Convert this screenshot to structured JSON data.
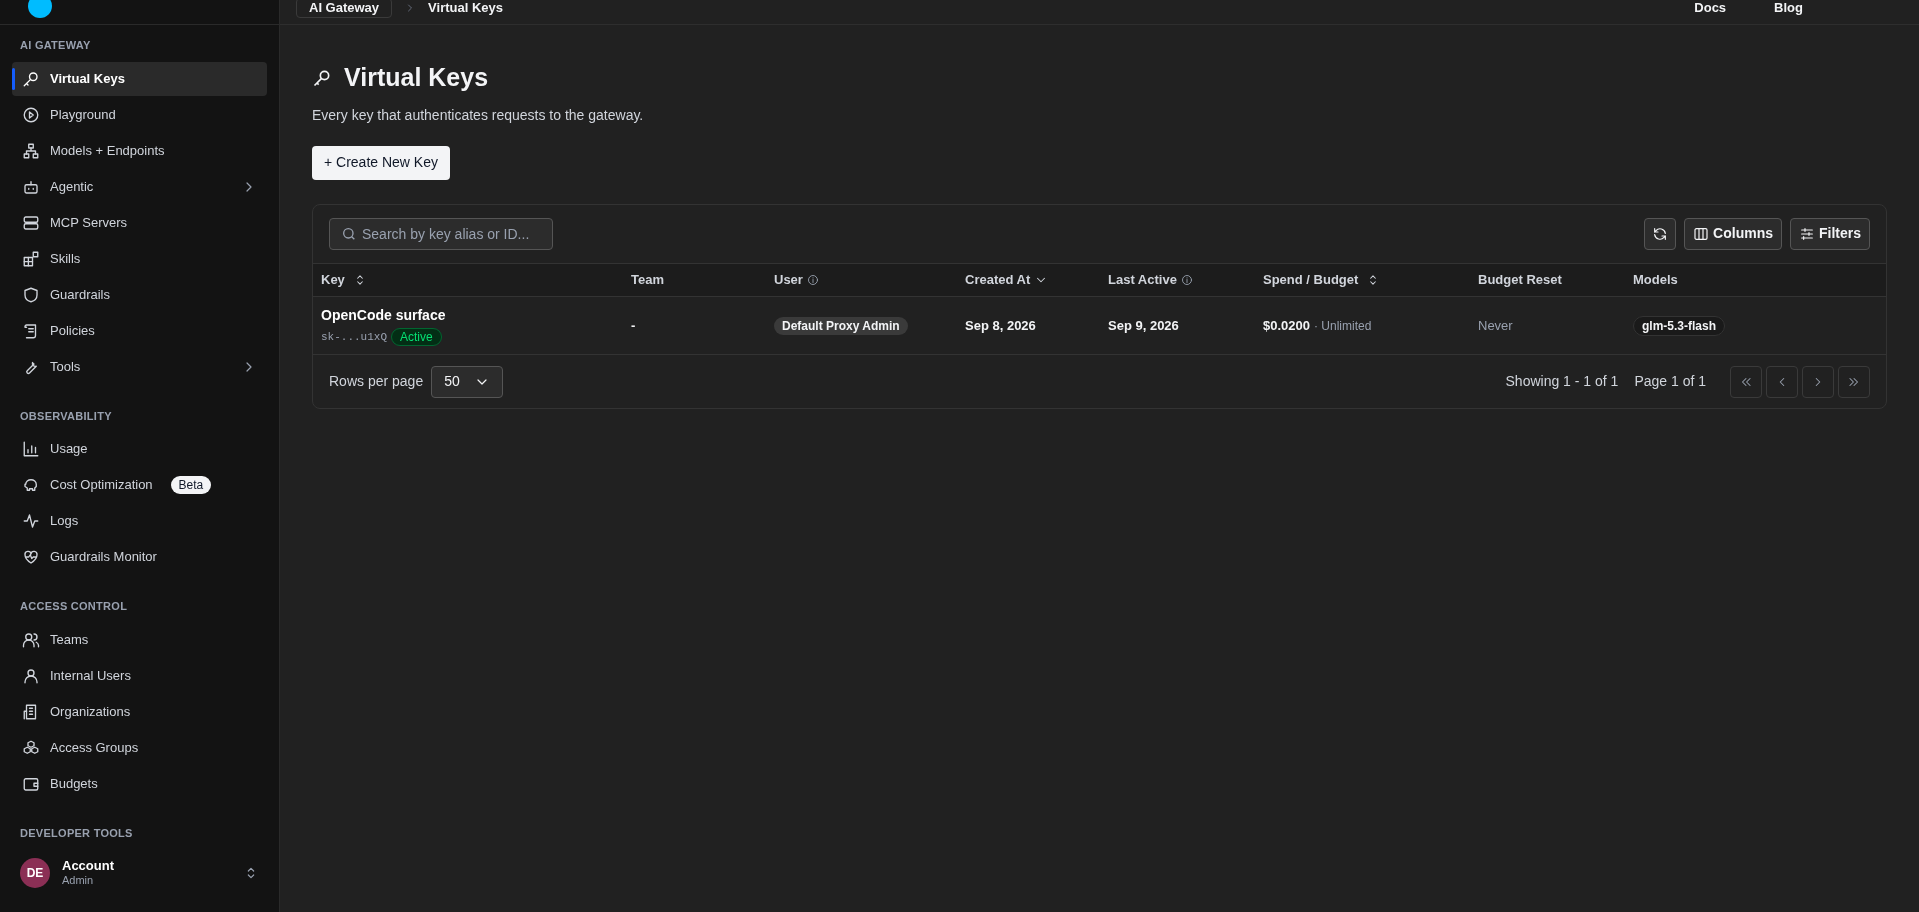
{
  "top_bar": {
    "breadcrumb": [
      "AI Gateway",
      "Virtual Keys"
    ],
    "links": [
      "Docs",
      "Blog"
    ]
  },
  "sidebar": {
    "sections": [
      {
        "title": "AI GATEWAY",
        "items": [
          {
            "label": "Virtual Keys",
            "selected": true,
            "expandable": false
          },
          {
            "label": "Playground",
            "selected": false,
            "expandable": false
          },
          {
            "label": "Models + Endpoints",
            "selected": false,
            "expandable": false
          },
          {
            "label": "Agentic",
            "selected": false,
            "expandable": true
          },
          {
            "label": "MCP Servers",
            "selected": false,
            "expandable": false
          },
          {
            "label": "Skills",
            "selected": false,
            "expandable": false
          },
          {
            "label": "Guardrails",
            "selected": false,
            "expandable": false
          },
          {
            "label": "Policies",
            "selected": false,
            "expandable": false
          },
          {
            "label": "Tools",
            "selected": false,
            "expandable": true
          }
        ]
      },
      {
        "title": "OBSERVABILITY",
        "items": [
          {
            "label": "Usage",
            "selected": false,
            "expandable": false
          },
          {
            "label": "Cost Optimization",
            "selected": false,
            "expandable": false,
            "badge": "Beta"
          },
          {
            "label": "Logs",
            "selected": false,
            "expandable": false
          },
          {
            "label": "Guardrails Monitor",
            "selected": false,
            "expandable": false
          }
        ]
      },
      {
        "title": "ACCESS CONTROL",
        "items": [
          {
            "label": "Teams",
            "selected": false,
            "expandable": false
          },
          {
            "label": "Internal Users",
            "selected": false,
            "expandable": false
          },
          {
            "label": "Organizations",
            "selected": false,
            "expandable": false
          },
          {
            "label": "Access Groups",
            "selected": false,
            "expandable": false
          },
          {
            "label": "Budgets",
            "selected": false,
            "expandable": false
          }
        ]
      },
      {
        "title": "DEVELOPER TOOLS"
      }
    ],
    "account": {
      "initials": "DE",
      "name": "Account",
      "role": "Admin"
    }
  },
  "page": {
    "title": "Virtual Keys",
    "subtitle": "Every key that authenticates requests to the gateway.",
    "create_button": "+ Create New Key"
  },
  "table": {
    "search": {
      "placeholder": "Search by key alias or ID..."
    },
    "toolbar": [
      "Columns",
      "Filters"
    ],
    "columns": [
      {
        "label": "Key",
        "kind": "sortable"
      },
      {
        "label": "Team",
        "kind": "plain"
      },
      {
        "label": "User",
        "kind": "info"
      },
      {
        "label": "Created At",
        "kind": "sorted"
      },
      {
        "label": "Last Active",
        "kind": "info"
      },
      {
        "label": "Spend / Budget",
        "kind": "sortable"
      },
      {
        "label": "Budget Reset",
        "kind": "plain"
      },
      {
        "label": "Models",
        "kind": "plain"
      }
    ],
    "rows": [
      {
        "alias": "OpenCode surface",
        "key": "sk-...u1xQ",
        "status": "Active",
        "team": "-",
        "user": "Default Proxy Admin",
        "created": "Sep 8, 2026",
        "last_active": "Sep 9, 2026",
        "spend": "$0.0200",
        "budget": "· Unlimited",
        "budget_reset": "Never",
        "models": [
          "glm-5.3-flash"
        ]
      }
    ],
    "footer": {
      "rows_label": "Rows per page",
      "rows_value": "50",
      "showing": "Showing 1 - 1 of 1",
      "page": "Page 1 of 1"
    }
  }
}
